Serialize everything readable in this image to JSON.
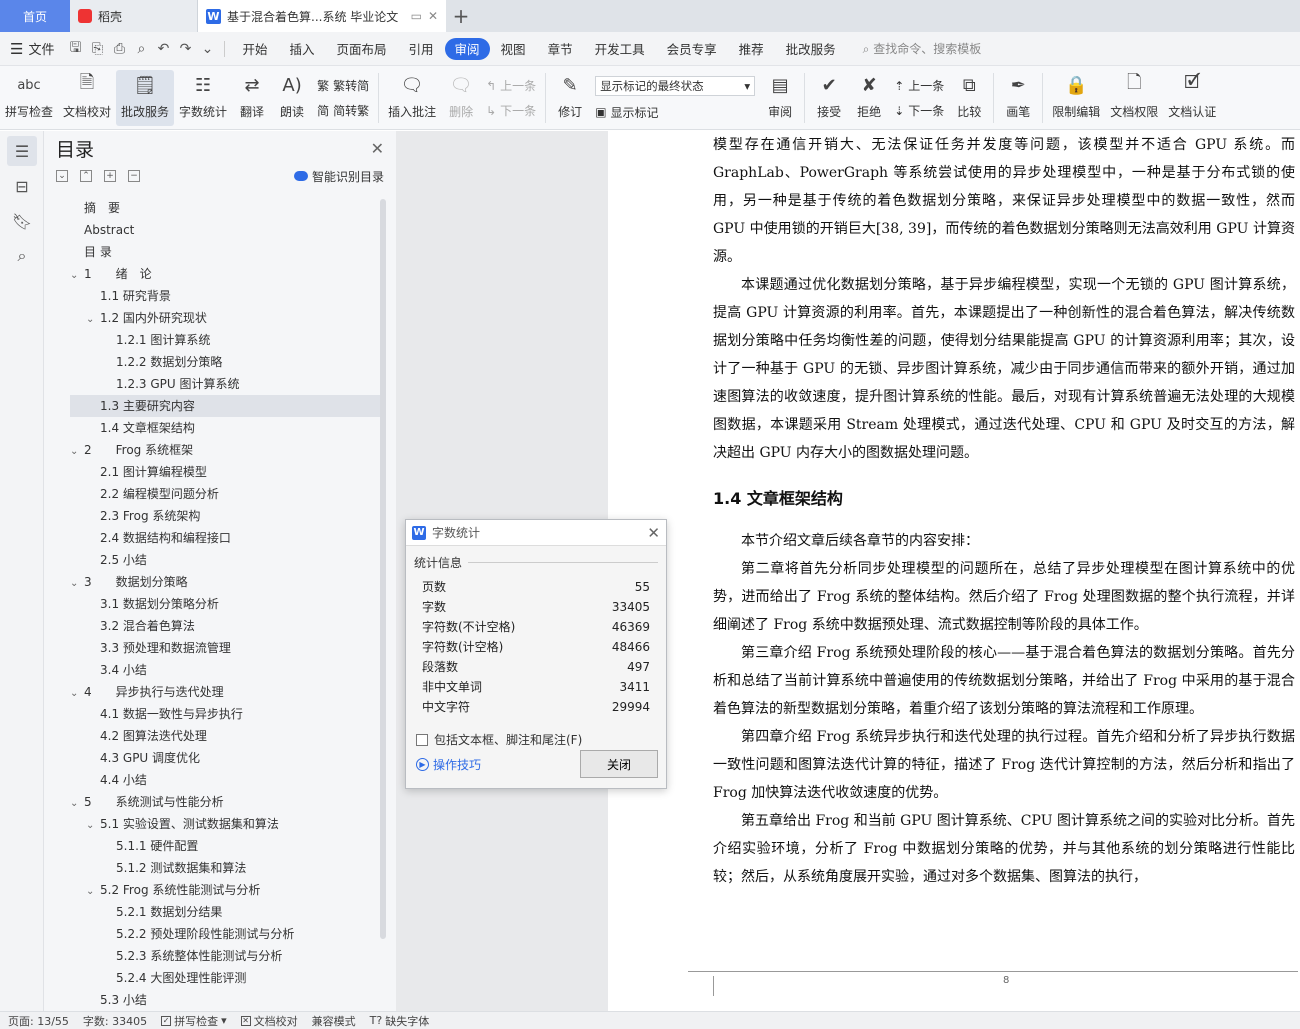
{
  "tabs": {
    "home": "首页",
    "docer": "稻壳",
    "doc_title": "基于混合着色算...系统 毕业论文",
    "add": "+"
  },
  "menu": {
    "file": "文件",
    "items": [
      "开始",
      "插入",
      "页面布局",
      "引用",
      "审阅",
      "视图",
      "章节",
      "开发工具",
      "会员专享",
      "推荐",
      "批改服务"
    ],
    "active_index": 4,
    "search": "查找命令、搜索模板"
  },
  "ribbon": {
    "spell": "拼写检查",
    "proofread": "文档校对",
    "correct_service": "批改服务",
    "word_count": "字数统计",
    "translate": "翻译",
    "read_aloud": "朗读",
    "trad": "繁转简",
    "simp": "简转繁",
    "insert_comment": "插入批注",
    "delete": "删除",
    "prev": "上一条",
    "next": "下一条",
    "revise": "修订",
    "markup_select": "显示标记的最终状态",
    "show_markup": "显示标记",
    "review": "审阅",
    "accept": "接受",
    "reject": "拒绝",
    "prev2": "上一条",
    "next2": "下一条",
    "compare": "比较",
    "pen": "画笔",
    "restrict": "限制编辑",
    "doc_rights": "文档权限",
    "doc_cert": "文档认证"
  },
  "toc": {
    "title": "目录",
    "smart": "智能识别目录",
    "items": [
      {
        "label": "摘　要",
        "level": 0,
        "caret": ""
      },
      {
        "label": "Abstract",
        "level": 0,
        "caret": ""
      },
      {
        "label": "目 录",
        "level": 0,
        "caret": ""
      },
      {
        "label": "1　　绪　论",
        "level": 0,
        "caret": "⌄"
      },
      {
        "label": "1.1  研究背景",
        "level": 1,
        "caret": ""
      },
      {
        "label": "1.2  国内外研究现状",
        "level": 1,
        "caret": "⌄"
      },
      {
        "label": "1.2.1  图计算系统",
        "level": 2,
        "caret": ""
      },
      {
        "label": "1.2.2  数据划分策略",
        "level": 2,
        "caret": ""
      },
      {
        "label": "1.2.3 GPU 图计算系统",
        "level": 2,
        "caret": ""
      },
      {
        "label": "1.3  主要研究内容",
        "level": 1,
        "caret": "",
        "selected": true
      },
      {
        "label": "1.4  文章框架结构",
        "level": 1,
        "caret": ""
      },
      {
        "label": "2　　Frog 系统框架",
        "level": 0,
        "caret": "⌄"
      },
      {
        "label": "2.1  图计算编程模型",
        "level": 1,
        "caret": ""
      },
      {
        "label": "2.2  编程模型问题分析",
        "level": 1,
        "caret": ""
      },
      {
        "label": "2.3 Frog 系统架构",
        "level": 1,
        "caret": ""
      },
      {
        "label": "2.4  数据结构和编程接口",
        "level": 1,
        "caret": ""
      },
      {
        "label": "2.5  小结",
        "level": 1,
        "caret": ""
      },
      {
        "label": "3　　数据划分策略",
        "level": 0,
        "caret": "⌄"
      },
      {
        "label": "3.1  数据划分策略分析",
        "level": 1,
        "caret": ""
      },
      {
        "label": "3.2  混合着色算法",
        "level": 1,
        "caret": ""
      },
      {
        "label": "3.3  预处理和数据流管理",
        "level": 1,
        "caret": ""
      },
      {
        "label": "3.4  小结",
        "level": 1,
        "caret": ""
      },
      {
        "label": "4　　异步执行与迭代处理",
        "level": 0,
        "caret": "⌄"
      },
      {
        "label": "4.1  数据一致性与异步执行",
        "level": 1,
        "caret": ""
      },
      {
        "label": "4.2  图算法迭代处理",
        "level": 1,
        "caret": ""
      },
      {
        "label": "4.3 GPU 调度优化",
        "level": 1,
        "caret": ""
      },
      {
        "label": "4.4  小结",
        "level": 1,
        "caret": ""
      },
      {
        "label": "5　　系统测试与性能分析",
        "level": 0,
        "caret": "⌄"
      },
      {
        "label": "5.1  实验设置、测试数据集和算法",
        "level": 1,
        "caret": "⌄"
      },
      {
        "label": "5.1.1 硬件配置",
        "level": 2,
        "caret": ""
      },
      {
        "label": "5.1.2 测试数据集和算法",
        "level": 2,
        "caret": ""
      },
      {
        "label": "5.2 Frog 系统性能测试与分析",
        "level": 1,
        "caret": "⌄"
      },
      {
        "label": "5.2.1  数据划分结果",
        "level": 2,
        "caret": ""
      },
      {
        "label": "5.2.2  预处理阶段性能测试与分析",
        "level": 2,
        "caret": ""
      },
      {
        "label": "5.2.3  系统整体性能测试与分析",
        "level": 2,
        "caret": ""
      },
      {
        "label": "5.2.4  大图处理性能评测",
        "level": 2,
        "caret": ""
      },
      {
        "label": "5.3  小结",
        "level": 1,
        "caret": ""
      }
    ]
  },
  "document": {
    "p1": "模型存在通信开销大、无法保证任务并发度等问题，该模型并不适合 GPU 系统。而 GraphLab、PowerGraph 等系统尝试使用的异步处理模型中，一种是基于分布式锁的使用，另一种是基于传统的着色数据划分策略，来保证异步处理模型中的数据一致性，然而 GPU 中使用锁的开销巨大[38, 39]，而传统的着色数据划分策略则无法高效利用 GPU 计算资源。",
    "p2": "本课题通过优化数据划分策略，基于异步编程模型，实现一个无锁的 GPU 图计算系统，提高 GPU 计算资源的利用率。首先，本课题提出了一种创新性的混合着色算法，解决传统数据划分策略中任务均衡性差的问题，使得划分结果能提高 GPU 的计算资源利用率；其次，设计了一种基于 GPU 的无锁、异步图计算系统，减少由于同步通信而带来的额外开销，通过加速图算法的收敛速度，提升图计算系统的性能。最后，对现有计算系统普遍无法处理的大规模图数据，本课题采用 Stream 处理模式，通过迭代处理、CPU 和 GPU 及时交互的方法，解决超出 GPU 内存大小的图数据处理问题。",
    "heading": "1.4  文章框架结构",
    "p3": "本节介绍文章后续各章节的内容安排：",
    "p4": "第二章将首先分析同步处理模型的问题所在，总结了异步处理模型在图计算系统中的优势，进而给出了 Frog 系统的整体结构。然后介绍了 Frog 处理图数据的整个执行流程，并详细阐述了 Frog 系统中数据预处理、流式数据控制等阶段的具体工作。",
    "p5": "第三章介绍 Frog 系统预处理阶段的核心——基于混合着色算法的数据划分策略。首先分析和总结了当前计算系统中普遍使用的传统数据划分策略，并给出了 Frog 中采用的基于混合着色算法的新型数据划分策略，着重介绍了该划分策略的算法流程和工作原理。",
    "p6": "第四章介绍 Frog 系统异步执行和迭代处理的执行过程。首先介绍和分析了异步执行数据一致性问题和图算法迭代计算的特征，描述了 Frog 迭代计算控制的方法，然后分析和指出了 Frog 加快算法迭代收敛速度的优势。",
    "p7": "第五章给出 Frog 和当前 GPU 图计算系统、CPU 图计算系统之间的实验对比分析。首先介绍实验环境，分析了 Frog 中数据划分策略的优势，并与其他系统的划分策略进行性能比较；然后，从系统角度展开实验，通过对多个数据集、图算法的执行，",
    "page_number": "8"
  },
  "dialog": {
    "title": "字数统计",
    "section": "统计信息",
    "stats": [
      {
        "label": "页数",
        "value": "55"
      },
      {
        "label": "字数",
        "value": "33405"
      },
      {
        "label": "字符数(不计空格)",
        "value": "46369"
      },
      {
        "label": "字符数(计空格)",
        "value": "48466"
      },
      {
        "label": "段落数",
        "value": "497"
      },
      {
        "label": "非中文单词",
        "value": "3411"
      },
      {
        "label": "中文字符",
        "value": "29994"
      }
    ],
    "include_label": "包括文本框、脚注和尾注(F)",
    "tips": "操作技巧",
    "close": "关闭"
  },
  "status": {
    "page": "页面: 13/55",
    "words": "字数: 33405",
    "spell": "拼写检查",
    "proof": "文档校对",
    "compat": "兼容模式",
    "missing_font": "缺失字体"
  }
}
